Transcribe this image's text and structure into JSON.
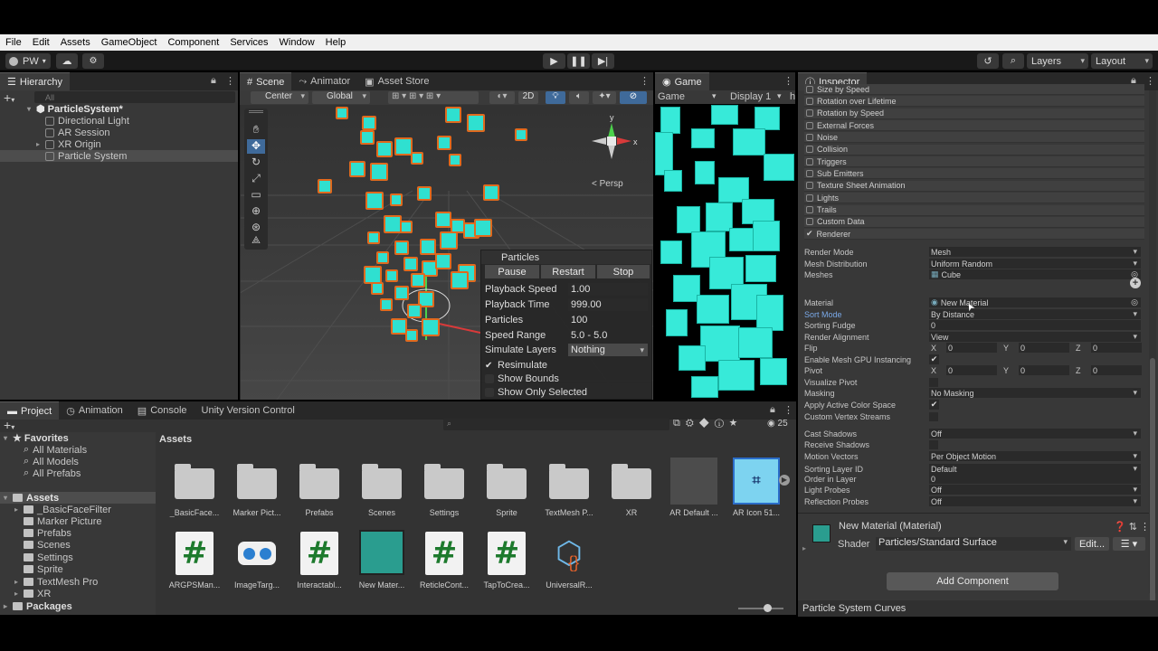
{
  "menubar": {
    "items": [
      "File",
      "Edit",
      "Assets",
      "GameObject",
      "Component",
      "Services",
      "Window",
      "Help"
    ]
  },
  "toolbar": {
    "account": "PW",
    "layers": "Layers",
    "layout": "Layout"
  },
  "hierarchy": {
    "tab": "Hierarchy",
    "search_placeholder": "All",
    "scene": "ParticleSystem*",
    "items": [
      "Directional Light",
      "AR Session",
      "XR Origin",
      "Particle System"
    ]
  },
  "scene": {
    "tabs": [
      "Scene",
      "Animator",
      "Asset Store"
    ],
    "pivot": "Center",
    "space": "Global",
    "mode2d": "2D",
    "persp": "< Persp"
  },
  "particles_overlay": {
    "title": "Particles",
    "buttons": [
      "Pause",
      "Restart",
      "Stop"
    ],
    "rows": [
      {
        "label": "Playback Speed",
        "value": "1.00"
      },
      {
        "label": "Playback Time",
        "value": "999.00"
      },
      {
        "label": "Particles",
        "value": "100"
      },
      {
        "label": "Speed Range",
        "value": "5.0 - 5.0"
      },
      {
        "label": "Simulate Layers",
        "value": "Nothing"
      }
    ],
    "checks": [
      {
        "label": "Resimulate",
        "checked": true
      },
      {
        "label": "Show Bounds",
        "checked": false
      },
      {
        "label": "Show Only Selected",
        "checked": false
      }
    ]
  },
  "game": {
    "tab": "Game",
    "display": "Game",
    "display_num": "Display 1",
    "trunc": "h"
  },
  "inspector": {
    "tab": "Inspector",
    "modules": [
      "Size by Speed",
      "Rotation over Lifetime",
      "Rotation by Speed",
      "External Forces",
      "Noise",
      "Collision",
      "Triggers",
      "Sub Emitters",
      "Texture Sheet Animation",
      "Lights",
      "Trails",
      "Custom Data",
      "Renderer"
    ],
    "props": [
      {
        "label": "Render Mode",
        "value": "Mesh"
      },
      {
        "label": "Mesh Distribution",
        "value": "Uniform Random"
      },
      {
        "label": "Meshes",
        "value": "Cube"
      },
      {
        "label": "Material",
        "value": "New Material"
      },
      {
        "label": "Sort Mode",
        "value": "By Distance"
      },
      {
        "label": "Sorting Fudge",
        "value": "0"
      },
      {
        "label": "Render Alignment",
        "value": "View"
      },
      {
        "label": "Flip",
        "value": ""
      },
      {
        "label": "Enable Mesh GPU Instancing",
        "value": ""
      },
      {
        "label": "Pivot",
        "value": ""
      },
      {
        "label": "Visualize Pivot",
        "value": ""
      },
      {
        "label": "Masking",
        "value": "No Masking"
      },
      {
        "label": "Apply Active Color Space",
        "value": ""
      },
      {
        "label": "Custom Vertex Streams",
        "value": ""
      },
      {
        "label": "Cast Shadows",
        "value": "Off"
      },
      {
        "label": "Receive Shadows",
        "value": ""
      },
      {
        "label": "Motion Vectors",
        "value": "Per Object Motion"
      },
      {
        "label": "Sorting Layer ID",
        "value": "Default"
      },
      {
        "label": "Order in Layer",
        "value": "0"
      },
      {
        "label": "Light Probes",
        "value": "Off"
      },
      {
        "label": "Reflection Probes",
        "value": "Off"
      }
    ],
    "xyz": {
      "x": "X",
      "y": "Y",
      "z": "Z",
      "zero": "0"
    },
    "material_title": "New Material (Material)",
    "shader_label": "Shader",
    "shader_value": "Particles/Standard Surface",
    "edit": "Edit...",
    "add_component": "Add Component",
    "curves": "Particle System Curves"
  },
  "project": {
    "tabs": [
      "Project",
      "Animation",
      "Console",
      "Unity Version Control"
    ],
    "count": "25",
    "favorites": "Favorites",
    "fav_items": [
      "All Materials",
      "All Models",
      "All Prefabs"
    ],
    "assets_root": "Assets",
    "asset_folders": [
      "_BasicFaceFilter",
      "Marker Picture",
      "Prefabs",
      "Scenes",
      "Settings",
      "Sprite",
      "TextMesh Pro",
      "XR"
    ],
    "packages": "Packages",
    "breadcrumb": "Assets",
    "row1": [
      "_BasicFace...",
      "Marker Pict...",
      "Prefabs",
      "Scenes",
      "Settings",
      "Sprite",
      "TextMesh P...",
      "XR",
      "AR Default ...",
      "AR Icon 51..."
    ],
    "row2": [
      "ARGPSMan...",
      "ImageTarg...",
      "Interactabl...",
      "New Mater...",
      "ReticleCont...",
      "TapToCrea...",
      "UniversalR..."
    ]
  }
}
